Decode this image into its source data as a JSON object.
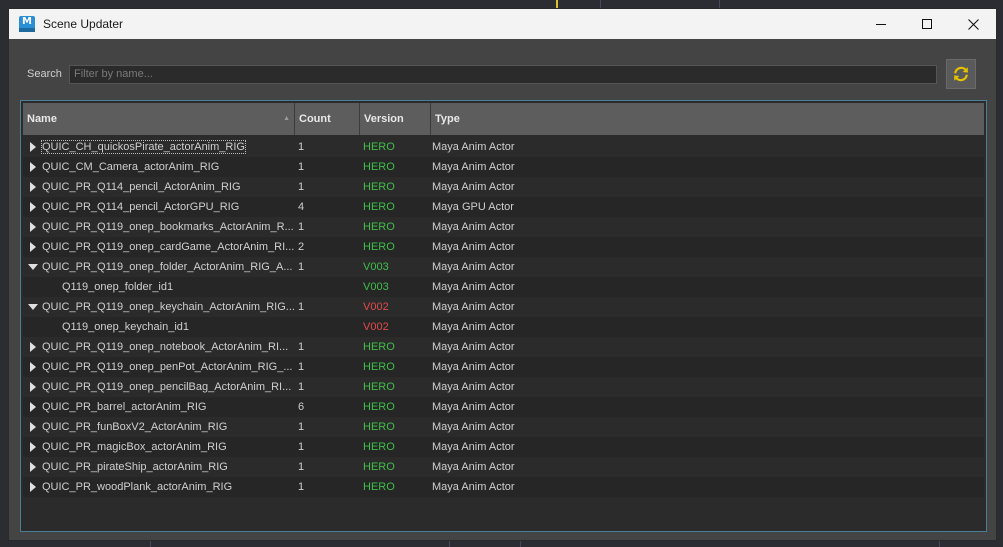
{
  "window": {
    "title": "Scene Updater",
    "icon": "maya-icon",
    "icon_letter": "M"
  },
  "search": {
    "label": "Search",
    "placeholder": "Filter by name...",
    "value": ""
  },
  "columns": {
    "name": "Name",
    "count": "Count",
    "version": "Version",
    "type": "Type"
  },
  "colors": {
    "hero": "#3fbf4a",
    "current_version": "#3fbf4a",
    "outdated_version": "#e04a4a",
    "refresh_icon": "#e6c200"
  },
  "rows": [
    {
      "name": "QUIC_CH_quickosPirate_actorAnim_RIG",
      "count": "1",
      "version": "HERO",
      "type": "Maya Anim Actor",
      "expanded": false,
      "child": false
    },
    {
      "name": "QUIC_CM_Camera_actorAnim_RIG",
      "count": "1",
      "version": "HERO",
      "type": "Maya Anim Actor",
      "expanded": false,
      "child": false
    },
    {
      "name": "QUIC_PR_Q114_pencil_ActorAnim_RIG",
      "count": "1",
      "version": "HERO",
      "type": "Maya Anim Actor",
      "expanded": false,
      "child": false
    },
    {
      "name": "QUIC_PR_Q114_pencil_ActorGPU_RIG",
      "count": "4",
      "version": "HERO",
      "type": "Maya GPU Actor",
      "expanded": false,
      "child": false
    },
    {
      "name": "QUIC_PR_Q119_onep_bookmarks_ActorAnim_R...",
      "count": "1",
      "version": "HERO",
      "type": "Maya Anim Actor",
      "expanded": false,
      "child": false
    },
    {
      "name": "QUIC_PR_Q119_onep_cardGame_ActorAnim_RI...",
      "count": "2",
      "version": "HERO",
      "type": "Maya Anim Actor",
      "expanded": false,
      "child": false
    },
    {
      "name": "QUIC_PR_Q119_onep_folder_ActorAnim_RIG_A...",
      "count": "1",
      "version": "V003",
      "type": "Maya Anim Actor",
      "expanded": true,
      "child": false
    },
    {
      "name": "Q119_onep_folder_id1",
      "count": "",
      "version": "V003",
      "type": "Maya Anim Actor",
      "expanded": false,
      "child": true
    },
    {
      "name": "QUIC_PR_Q119_onep_keychain_ActorAnim_RIG...",
      "count": "1",
      "version": "V002",
      "type": "Maya Anim Actor",
      "expanded": true,
      "child": false
    },
    {
      "name": "Q119_onep_keychain_id1",
      "count": "",
      "version": "V002",
      "type": "Maya Anim Actor",
      "expanded": false,
      "child": true
    },
    {
      "name": "QUIC_PR_Q119_onep_notebook_ActorAnim_RI...",
      "count": "1",
      "version": "HERO",
      "type": "Maya Anim Actor",
      "expanded": false,
      "child": false
    },
    {
      "name": "QUIC_PR_Q119_onep_penPot_ActorAnim_RIG_...",
      "count": "1",
      "version": "HERO",
      "type": "Maya Anim Actor",
      "expanded": false,
      "child": false
    },
    {
      "name": "QUIC_PR_Q119_onep_pencilBag_ActorAnim_RI...",
      "count": "1",
      "version": "HERO",
      "type": "Maya Anim Actor",
      "expanded": false,
      "child": false
    },
    {
      "name": "QUIC_PR_barrel_actorAnim_RIG",
      "count": "6",
      "version": "HERO",
      "type": "Maya Anim Actor",
      "expanded": false,
      "child": false
    },
    {
      "name": "QUIC_PR_funBoxV2_ActorAnim_RIG",
      "count": "1",
      "version": "HERO",
      "type": "Maya Anim Actor",
      "expanded": false,
      "child": false
    },
    {
      "name": "QUIC_PR_magicBox_actorAnim_RIG",
      "count": "1",
      "version": "HERO",
      "type": "Maya Anim Actor",
      "expanded": false,
      "child": false
    },
    {
      "name": "QUIC_PR_pirateShip_actorAnim_RIG",
      "count": "1",
      "version": "HERO",
      "type": "Maya Anim Actor",
      "expanded": false,
      "child": false
    },
    {
      "name": "QUIC_PR_woodPlank_actorAnim_RIG",
      "count": "1",
      "version": "HERO",
      "type": "Maya Anim Actor",
      "expanded": false,
      "child": false
    }
  ]
}
